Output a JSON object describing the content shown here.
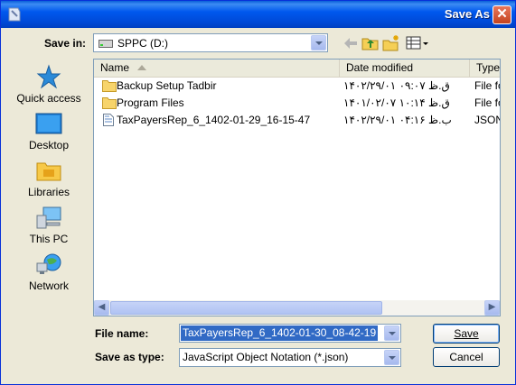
{
  "window": {
    "title": "Save As",
    "close_glyph": "✕"
  },
  "toolbar": {
    "save_in_label": "Save in:",
    "save_in_value": "SPPC (D:)",
    "back_icon": "back-arrow-icon",
    "up_icon": "up-one-level-icon",
    "new_folder_icon": "new-folder-icon",
    "views_icon": "views-menu-icon"
  },
  "places": [
    {
      "label": "Quick access"
    },
    {
      "label": "Desktop"
    },
    {
      "label": "Libraries"
    },
    {
      "label": "This PC"
    },
    {
      "label": "Network"
    }
  ],
  "columns": {
    "name": "Name",
    "date": "Date modified",
    "type": "Type"
  },
  "files": [
    {
      "name": "Backup Setup Tadbir",
      "date": "۱۴۰۲/۲۹/۰۱ ق.ظ ۰۹:۰۷",
      "type": "File fo"
    },
    {
      "name": "Program Files",
      "date": "۱۴۰۱/۰۲/۰۷ ق.ظ ۱۰:۱۴",
      "type": "File fo"
    },
    {
      "name": "TaxPayersRep_6_1402-01-29_16-15-47",
      "date": "۱۴۰۲/۲۹/۰۱ ب.ظ ۰۴:۱۶",
      "type": "JSON"
    }
  ],
  "footer": {
    "file_name_label": "File name:",
    "file_name_value": "TaxPayersRep_6_1402-01-30_08-42-19",
    "save_type_label": "Save as type:",
    "save_type_value": "JavaScript Object Notation (*.json)",
    "save_button": "Save",
    "cancel_button": "Cancel"
  },
  "colors": {
    "titlebar": "#0058ee",
    "dialog_bg": "#ece9d8",
    "selection": "#316ac5"
  }
}
